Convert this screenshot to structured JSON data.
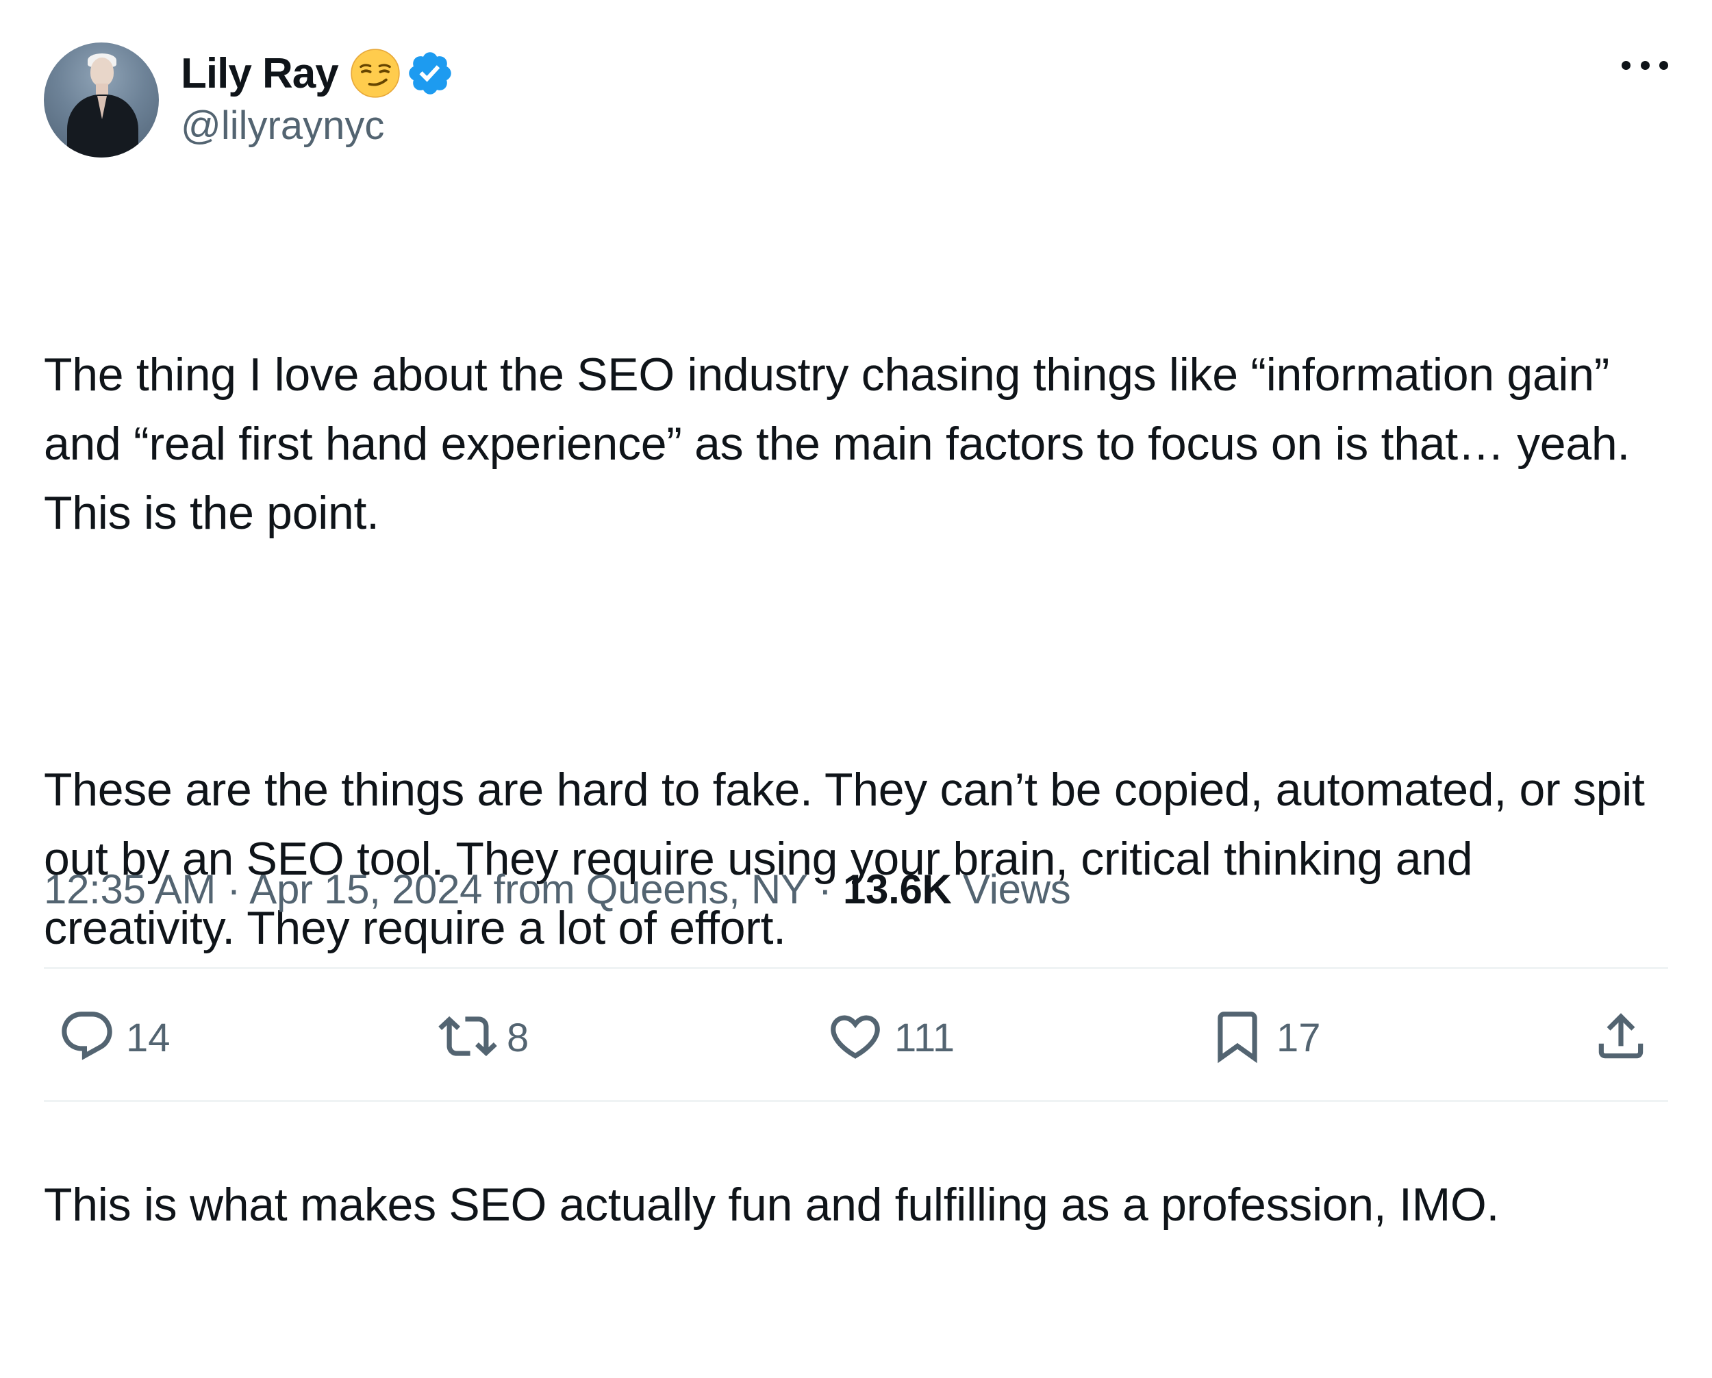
{
  "author": {
    "display_name": "Lily Ray",
    "handle": "@lilyraynyc",
    "emoji": "smirking-face-emoji",
    "verified": true,
    "verified_color": "#1d9bf0"
  },
  "tweet": {
    "paragraphs": [
      "The thing I love about the SEO industry chasing things like “information gain” and “real first hand experience” as the main factors to focus on is that… yeah. This is the point.",
      "These are the things are hard to fake. They can’t be copied, automated, or spit out by an SEO tool. They require using your brain, critical thinking and creativity. They require a lot of effort.",
      "This is what makes SEO actually fun and fulfilling as a profession, IMO."
    ],
    "time": "12:35 AM",
    "separator": "·",
    "date": "Apr 15, 2024",
    "location": "from Queens, NY",
    "views_count": "13.6K",
    "views_label": "Views"
  },
  "actions": {
    "reply_count": "14",
    "retweet_count": "8",
    "like_count": "111",
    "bookmark_count": "17"
  },
  "icons": {
    "more": "more-icon",
    "reply": "reply-icon",
    "retweet": "retweet-icon",
    "like": "heart-icon",
    "bookmark": "bookmark-icon",
    "share": "share-icon"
  },
  "colors": {
    "text_primary": "#0f1419",
    "text_secondary": "#536471",
    "divider": "#eff3f4"
  }
}
